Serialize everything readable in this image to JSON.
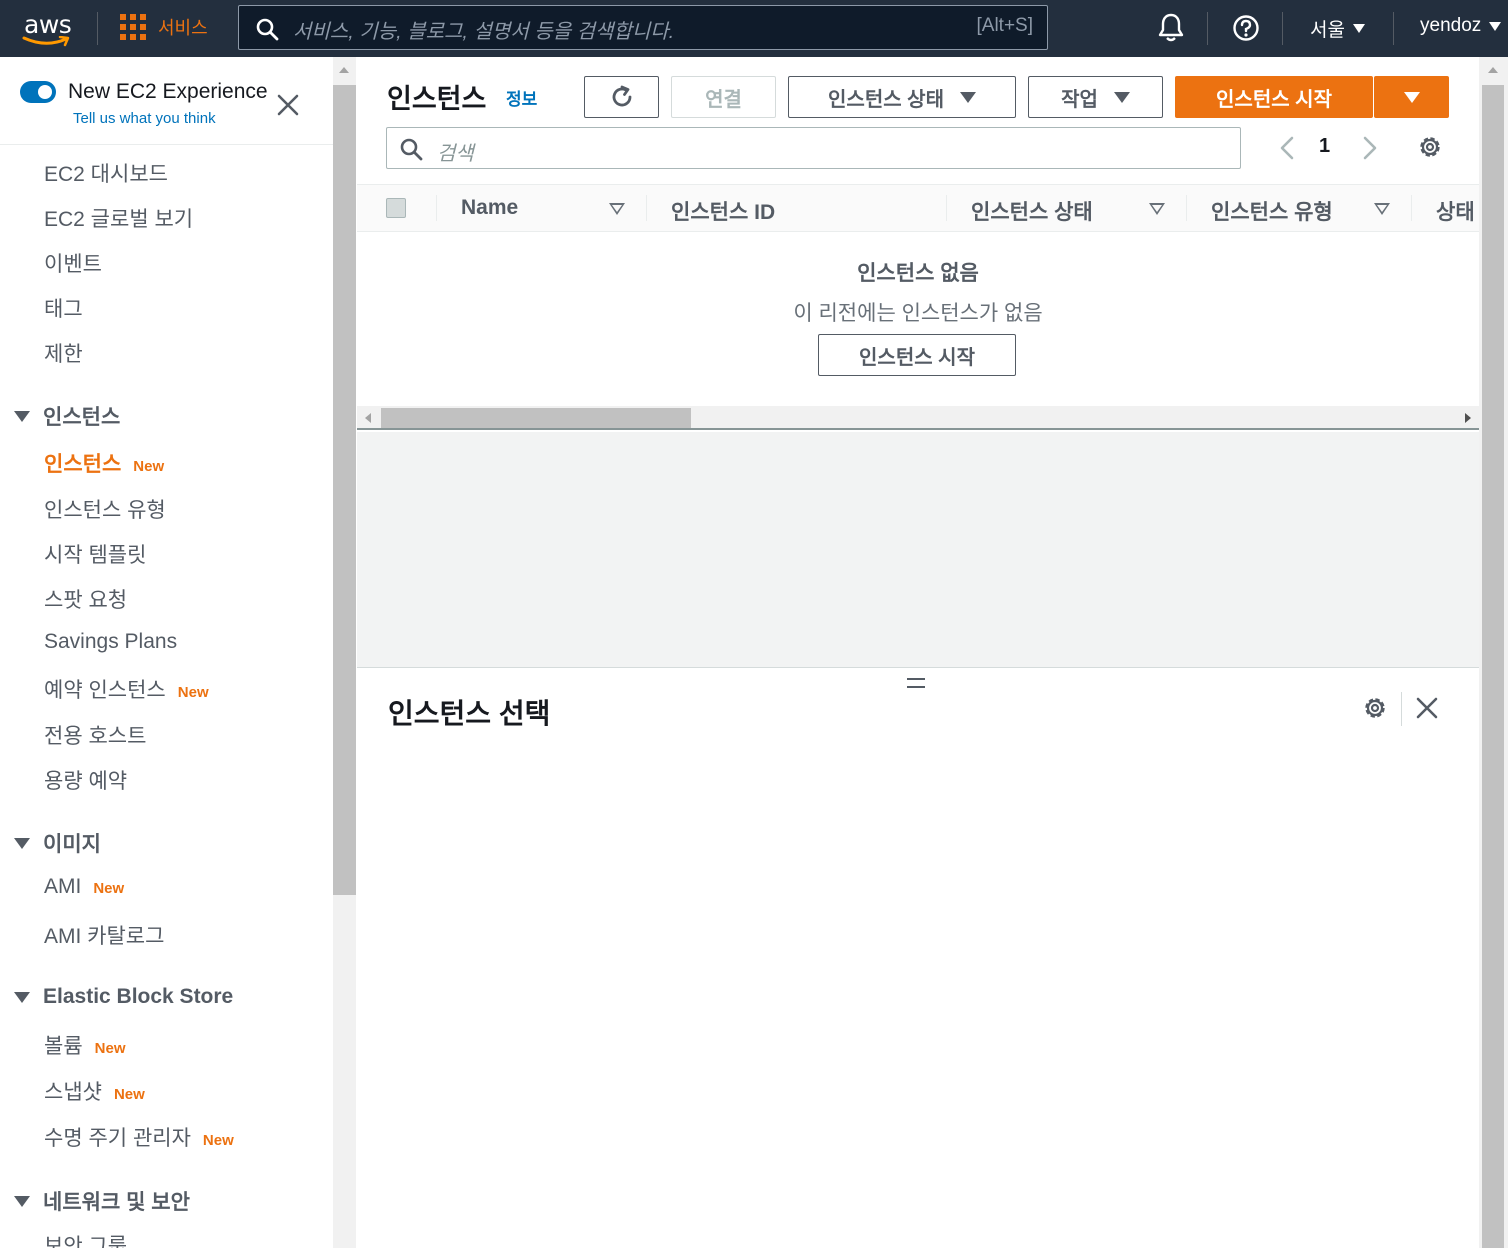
{
  "topnav": {
    "logo_text": "aws",
    "services_label": "서비스",
    "search_placeholder": "서비스, 기능, 블로그, 설명서 등을 검색합니다.",
    "search_shortcut": "[Alt+S]",
    "region": "서울",
    "user": "yendoz",
    "icons": [
      "bell-icon",
      "help-icon"
    ]
  },
  "sidebar": {
    "experience_toggle": {
      "label": "New EC2 Experience",
      "feedback": "Tell us what you think",
      "enabled": true
    },
    "top_items": [
      {
        "label": "EC2 대시보드"
      },
      {
        "label": "EC2 글로벌 보기"
      },
      {
        "label": "이벤트"
      },
      {
        "label": "태그"
      },
      {
        "label": "제한"
      }
    ],
    "sections": [
      {
        "title": "인스턴스",
        "items": [
          {
            "label": "인스턴스",
            "badge": "New",
            "active": true
          },
          {
            "label": "인스턴스 유형"
          },
          {
            "label": "시작 템플릿"
          },
          {
            "label": "스팟 요청"
          },
          {
            "label": "Savings Plans"
          },
          {
            "label": "예약 인스턴스",
            "badge": "New"
          },
          {
            "label": "전용 호스트"
          },
          {
            "label": "용량 예약"
          }
        ]
      },
      {
        "title": "이미지",
        "items": [
          {
            "label": "AMI",
            "badge": "New"
          },
          {
            "label": "AMI 카탈로그"
          }
        ]
      },
      {
        "title": "Elastic Block Store",
        "items": [
          {
            "label": "볼륨",
            "badge": "New"
          },
          {
            "label": "스냅샷",
            "badge": "New"
          },
          {
            "label": "수명 주기 관리자",
            "badge": "New"
          }
        ]
      },
      {
        "title": "네트워크 및 보안",
        "items": [
          {
            "label": "보안 그룹"
          }
        ]
      }
    ]
  },
  "main": {
    "title": "인스턴스",
    "info_link": "정보",
    "buttons": {
      "connect": "연결",
      "instance_state": "인스턴스 상태",
      "actions": "작업",
      "launch": "인스턴스 시작"
    },
    "search_placeholder": "검색",
    "page": "1",
    "columns": [
      "Name",
      "인스턴스 ID",
      "인스턴스 상태",
      "인스턴스 유형",
      "상태"
    ],
    "empty": {
      "title": "인스턴스 없음",
      "subtitle": "이 리전에는 인스턴스가 없음",
      "button": "인스턴스 시작"
    },
    "split_panel": {
      "title": "인스턴스 선택"
    }
  },
  "colors": {
    "nav_bg": "#232f3e",
    "accent": "#ec7211",
    "link": "#0073bb"
  }
}
